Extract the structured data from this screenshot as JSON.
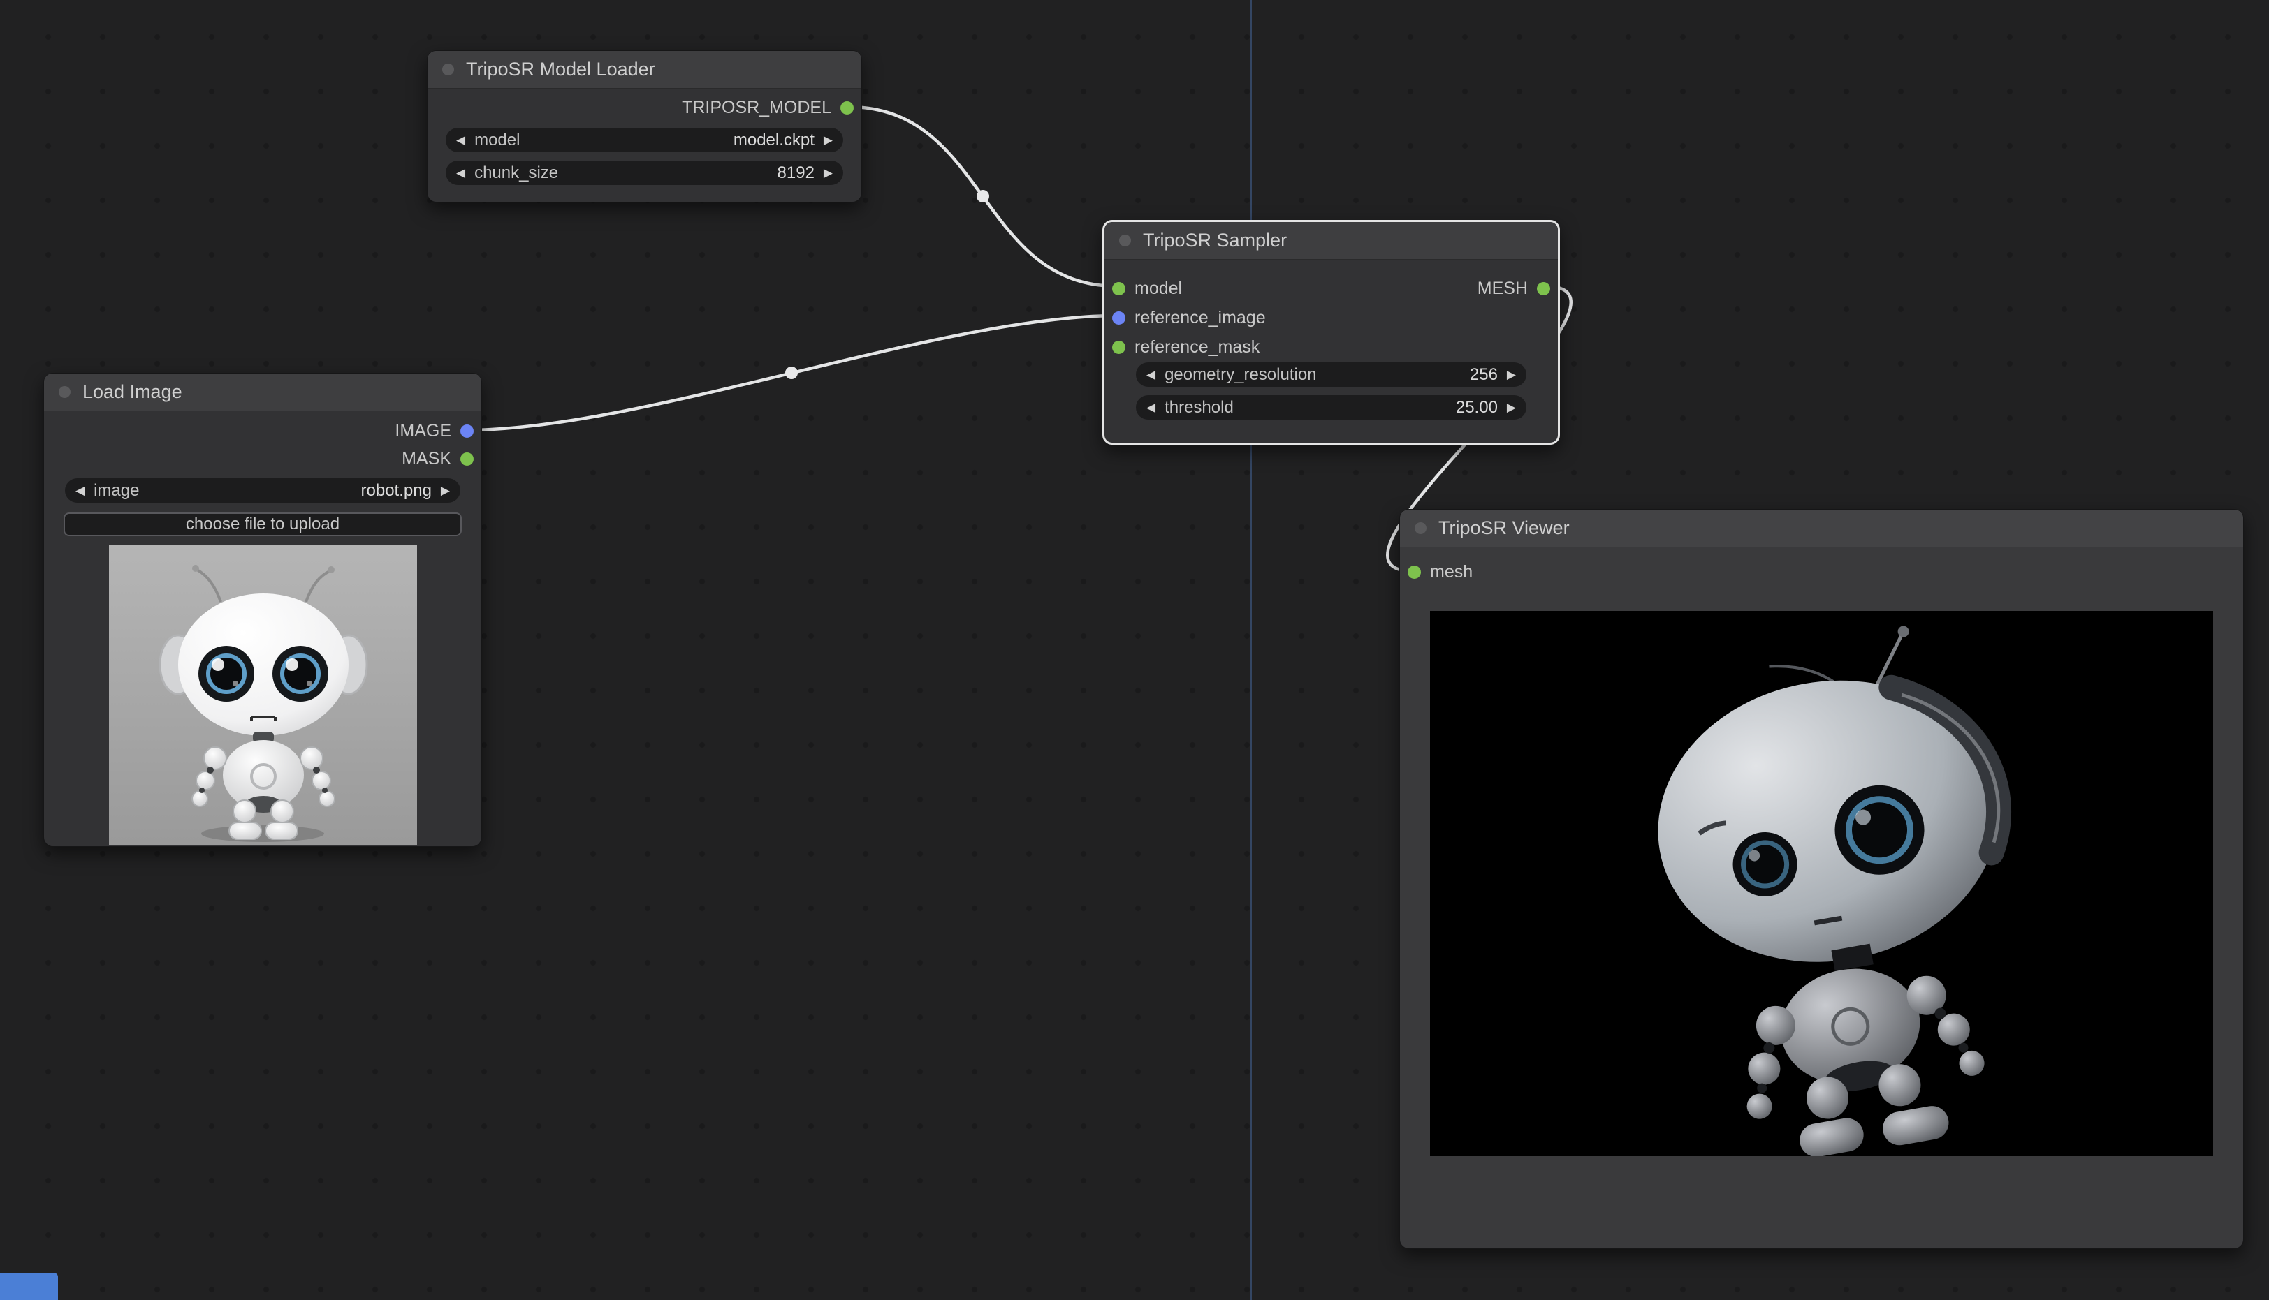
{
  "canvas": {
    "background": "#212122",
    "grid_dot_color": "#1a1a1b",
    "guide_line_color": "#5a8cdc",
    "corner_panel_color": "#4b7fd6"
  },
  "colors": {
    "wire": "#e4e5e6",
    "slot_green": "#7ec24d",
    "slot_blue": "#6c84f5",
    "node_body": "#323234",
    "node_title": "#3e3e40",
    "selected_border": "#e4e4e4"
  },
  "icons": {
    "arrow_left": "◀",
    "arrow_right": "▶"
  },
  "links": {
    "connections": [
      {
        "from": "TripoSR Model Loader.TRIPOSR_MODEL",
        "to": "TripoSR Sampler.model"
      },
      {
        "from": "Load Image.IMAGE",
        "to": "TripoSR Sampler.reference_image"
      },
      {
        "from": "TripoSR Sampler.MESH",
        "to": "TripoSR Viewer.mesh"
      }
    ]
  },
  "nodes": {
    "model_loader": {
      "title": "TripoSR Model Loader",
      "outputs": [
        {
          "label": "TRIPOSR_MODEL",
          "color": "green"
        }
      ],
      "widgets": [
        {
          "label": "model",
          "value": "model.ckpt"
        },
        {
          "label": "chunk_size",
          "value": "8192"
        }
      ]
    },
    "load_image": {
      "title": "Load Image",
      "outputs": [
        {
          "label": "IMAGE",
          "color": "blue"
        },
        {
          "label": "MASK",
          "color": "green"
        }
      ],
      "widgets": [
        {
          "label": "image",
          "value": "robot.png"
        }
      ],
      "upload_button": "choose file to upload"
    },
    "sampler": {
      "title": "TripoSR Sampler",
      "inputs": [
        {
          "label": "model",
          "color": "green"
        },
        {
          "label": "reference_image",
          "color": "blue"
        },
        {
          "label": "reference_mask",
          "color": "green"
        }
      ],
      "outputs": [
        {
          "label": "MESH",
          "color": "green"
        }
      ],
      "widgets": [
        {
          "label": "geometry_resolution",
          "value": "256"
        },
        {
          "label": "threshold",
          "value": "25.00"
        }
      ]
    },
    "viewer": {
      "title": "TripoSR Viewer",
      "inputs": [
        {
          "label": "mesh",
          "color": "green"
        }
      ]
    }
  }
}
